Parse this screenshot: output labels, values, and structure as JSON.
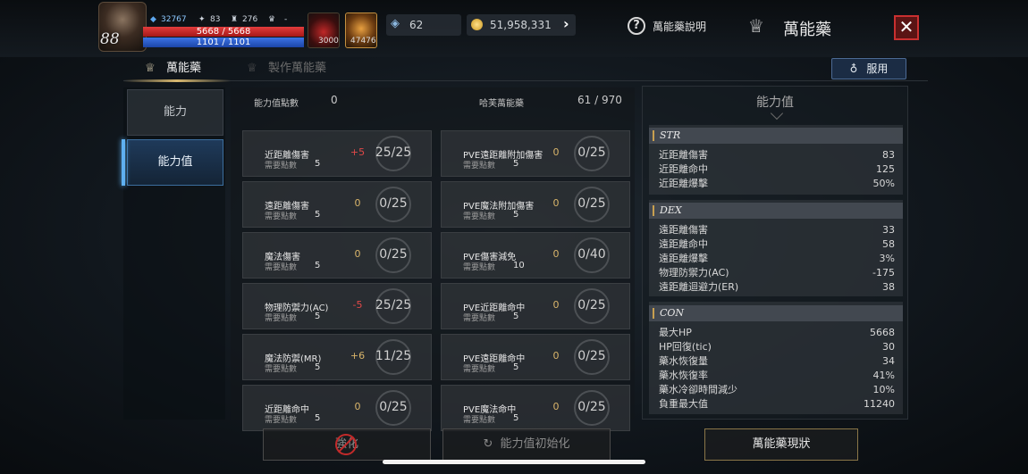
{
  "player": {
    "level": "88",
    "stat_a": "32767",
    "stat_b": "83",
    "stat_c": "276",
    "stat_d": "-",
    "hp": "5668 / 5668",
    "mp": "1101 / 1101"
  },
  "slots": {
    "potion_count": "3000",
    "weapon_count": "47476"
  },
  "currency": {
    "crystal": "62",
    "gold": "51,958,331"
  },
  "header": {
    "help_label": "萬能藥說明",
    "title": "萬能藥",
    "close": "✕"
  },
  "tabs": {
    "tab1": "萬能藥",
    "tab2": "製作萬能藥",
    "use_btn": "服用"
  },
  "sidebar": {
    "items": [
      {
        "label": "能力"
      },
      {
        "label": "能力值"
      }
    ]
  },
  "summary": {
    "points_label": "能力值點數",
    "points_value": "0",
    "elixir_label": "哈芙萬能藥",
    "elixir_value": "61 / 970"
  },
  "cards": [
    {
      "name": "近距離傷害",
      "req_label": "需要點數",
      "req": "5",
      "add": "+5",
      "count": "25/25",
      "add_color": "#e04848"
    },
    {
      "name": "PVE遠距離附加傷害",
      "req_label": "需要點數",
      "req": "5",
      "add": "0",
      "count": "0/25",
      "add_color": "#d8b46a"
    },
    {
      "name": "遠距離傷害",
      "req_label": "需要點數",
      "req": "5",
      "add": "0",
      "count": "0/25",
      "add_color": "#d8b46a"
    },
    {
      "name": "PVE魔法附加傷害",
      "req_label": "需要點數",
      "req": "5",
      "add": "0",
      "count": "0/25",
      "add_color": "#d8b46a"
    },
    {
      "name": "魔法傷害",
      "req_label": "需要點數",
      "req": "5",
      "add": "0",
      "count": "0/25",
      "add_color": "#d8b46a"
    },
    {
      "name": "PVE傷害減免",
      "req_label": "需要點數",
      "req": "10",
      "add": "0",
      "count": "0/40",
      "add_color": "#d8b46a"
    },
    {
      "name": "物理防禦力(AC)",
      "req_label": "需要點數",
      "req": "5",
      "add": "-5",
      "count": "25/25",
      "add_color": "#e04848"
    },
    {
      "name": "PVE近距離命中",
      "req_label": "需要點數",
      "req": "5",
      "add": "0",
      "count": "0/25",
      "add_color": "#d8b46a"
    },
    {
      "name": "魔法防禦(MR)",
      "req_label": "需要點數",
      "req": "5",
      "add": "+6",
      "count": "11/25",
      "add_color": "#d8b46a"
    },
    {
      "name": "PVE遠距離命中",
      "req_label": "需要點數",
      "req": "5",
      "add": "0",
      "count": "0/25",
      "add_color": "#d8b46a"
    },
    {
      "name": "近距離命中",
      "req_label": "需要點數",
      "req": "5",
      "add": "0",
      "count": "0/25",
      "add_color": "#d8b46a"
    },
    {
      "name": "PVE魔法命中",
      "req_label": "需要點數",
      "req": "5",
      "add": "0",
      "count": "0/25",
      "add_color": "#d8b46a"
    }
  ],
  "stats_panel": {
    "title": "能力值",
    "str": {
      "name": "STR",
      "rows": [
        {
          "label": "近距離傷害",
          "value": "83"
        },
        {
          "label": "近距離命中",
          "value": "125"
        },
        {
          "label": "近距離爆擊",
          "value": "50%"
        }
      ]
    },
    "dex": {
      "name": "DEX",
      "rows": [
        {
          "label": "遠距離傷害",
          "value": "33"
        },
        {
          "label": "遠距離命中",
          "value": "58"
        },
        {
          "label": "遠距離爆擊",
          "value": "3%"
        },
        {
          "label": "物理防禦力(AC)",
          "value": "-175"
        },
        {
          "label": "遠距離迴避力(ER)",
          "value": "38"
        }
      ]
    },
    "con": {
      "name": "CON",
      "rows": [
        {
          "label": "最大HP",
          "value": "5668"
        },
        {
          "label": "HP回復(tic)",
          "value": "30"
        },
        {
          "label": "藥水恢復量",
          "value": "34"
        },
        {
          "label": "藥水恢復率",
          "value": "41%"
        },
        {
          "label": "藥水冷卻時間減少",
          "value": "10%"
        },
        {
          "label": "負重最大值",
          "value": "11240"
        }
      ]
    }
  },
  "bottom": {
    "confirm": "強化",
    "reset": "能力值初始化",
    "status": "萬能藥現狀"
  }
}
